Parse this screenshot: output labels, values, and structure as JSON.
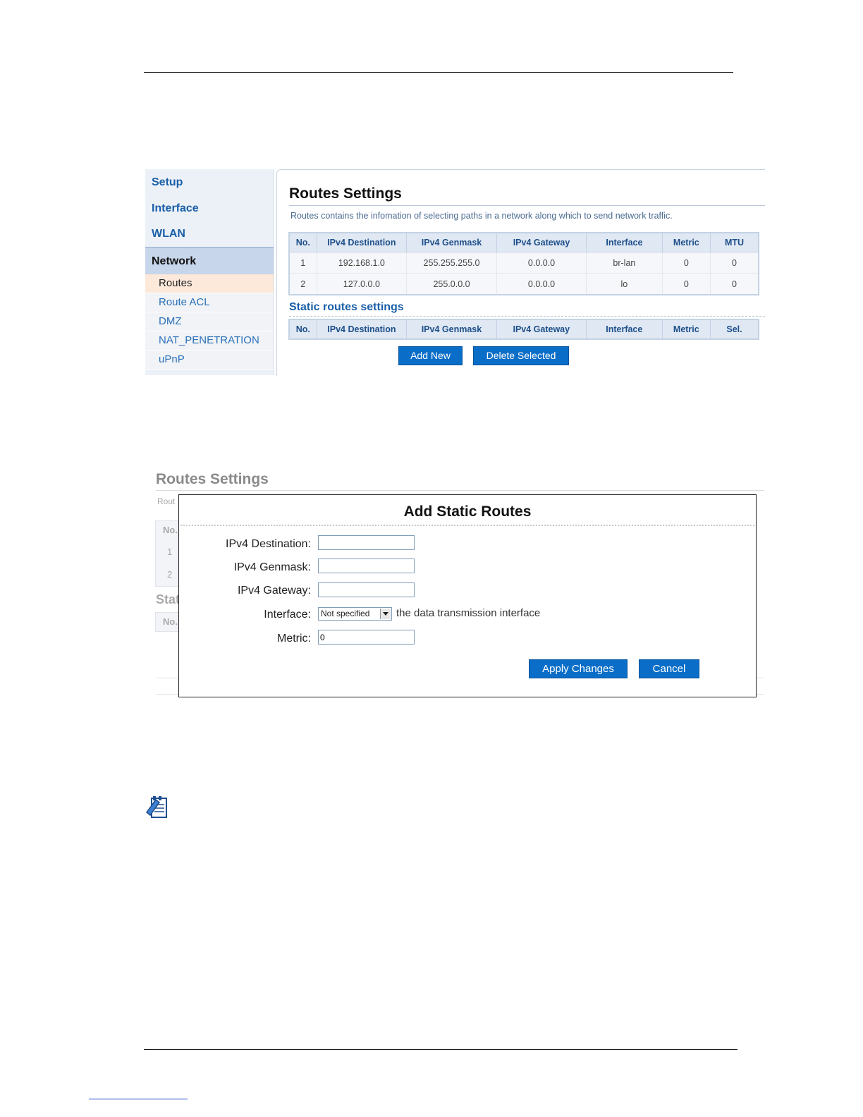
{
  "screenshot1": {
    "sidebar": {
      "top_items": [
        "Setup",
        "Interface",
        "WLAN"
      ],
      "active_section": "Network",
      "sub_items": [
        "Routes",
        "Route ACL",
        "DMZ",
        "NAT_PENETRATION",
        "uPnP"
      ],
      "active_sub": "Routes"
    },
    "title": "Routes Settings",
    "description": "Routes contains the infomation of selecting paths in a network along which to send network traffic.",
    "routes_table": {
      "headers": [
        "No.",
        "IPv4 Destination",
        "IPv4 Genmask",
        "IPv4 Gateway",
        "Interface",
        "Metric",
        "MTU"
      ],
      "rows": [
        [
          "1",
          "192.168.1.0",
          "255.255.255.0",
          "0.0.0.0",
          "br-lan",
          "0",
          "0"
        ],
        [
          "2",
          "127.0.0.0",
          "255.0.0.0",
          "0.0.0.0",
          "lo",
          "0",
          "0"
        ]
      ]
    },
    "static_title": "Static routes settings",
    "static_table": {
      "headers": [
        "No.",
        "IPv4 Destination",
        "IPv4 Genmask",
        "IPv4 Gateway",
        "Interface",
        "Metric",
        "Sel."
      ]
    },
    "buttons": {
      "add_new": "Add New",
      "delete_selected": "Delete Selected"
    }
  },
  "screenshot2": {
    "background": {
      "title": "Routes Settings",
      "desc_fragment": "Rout",
      "header_fragment": "No.",
      "row_numbers": [
        "1",
        "2"
      ],
      "static_fragment": "Stat",
      "static_header_fragment": "No."
    },
    "dialog": {
      "title": "Add Static Routes",
      "fields": {
        "destination_label": "IPv4 Destination:",
        "destination_value": "",
        "genmask_label": "IPv4 Genmask:",
        "genmask_value": "",
        "gateway_label": "IPv4 Gateway:",
        "gateway_value": "",
        "interface_label": "Interface:",
        "interface_selected": "Not specified",
        "interface_hint": "the data transmission interface",
        "metric_label": "Metric:",
        "metric_value": "0"
      },
      "buttons": {
        "apply": "Apply Changes",
        "cancel": "Cancel"
      }
    }
  },
  "icons": {
    "note": "notepad-icon"
  },
  "colors": {
    "accent": "#0a6ec8",
    "heading_blue": "#1a5fa8"
  }
}
